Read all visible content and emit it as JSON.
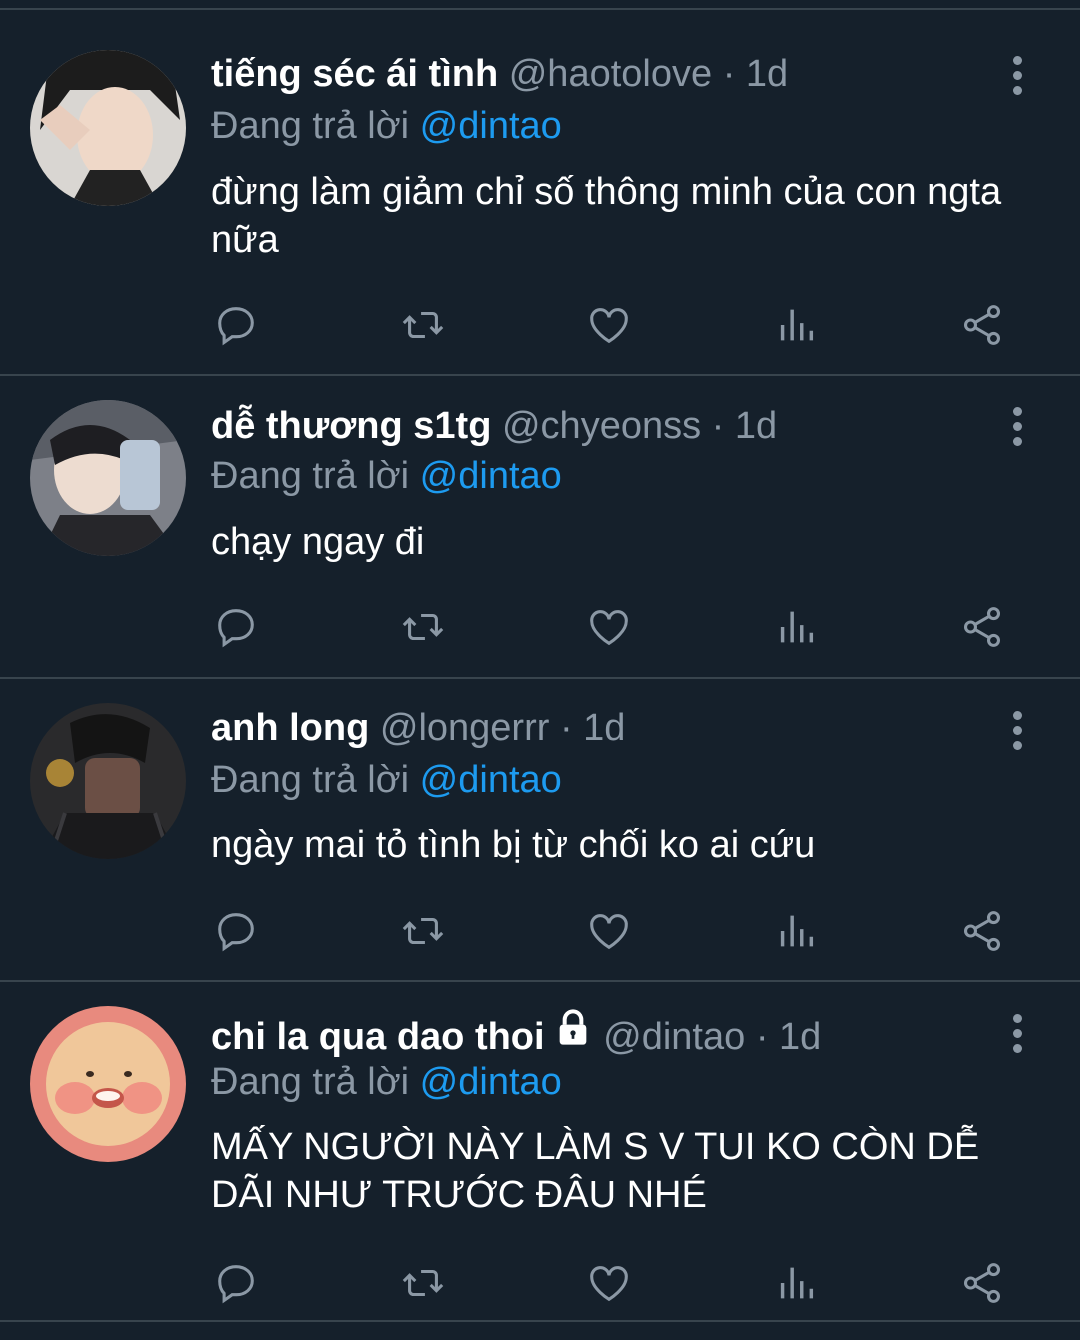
{
  "tweets": [
    {
      "name": "tiếng séc ái tình",
      "handle": "@haotolove",
      "time": "· 1d",
      "reply_prefix": "Đang trả lời",
      "reply_to": "@dintao",
      "text": "đừng làm giảm chỉ số thông minh của con ngta nữa",
      "avatar_color": "#3a3a3a",
      "locked": false
    },
    {
      "name": "dễ thương s1tg",
      "handle": "@chyeonss",
      "time": "· 1d",
      "reply_prefix": "Đang trả lời",
      "reply_to": "@dintao",
      "text": "chạy ngay đi",
      "avatar_color": "#4a4f57",
      "locked": false
    },
    {
      "name": "anh long",
      "handle": "@longerrr",
      "time": "· 1d",
      "reply_prefix": "Đang trả lời",
      "reply_to": "@dintao",
      "text": "ngày mai tỏ tình bị từ chối ko ai cứu",
      "avatar_color": "#2b2b2e",
      "locked": false
    },
    {
      "name": "chi la qua dao thoi",
      "handle": "@dintao",
      "time": "· 1d",
      "reply_prefix": "Đang trả lời",
      "reply_to": "@dintao",
      "text": "MẤY NGƯỜI NÀY LÀM S V TUI KO CÒN DỄ DÃI NHƯ TRƯỚC ĐÂU NHÉ",
      "avatar_color": "#e0857a",
      "locked": true
    }
  ],
  "icons": {
    "reply": "reply-icon",
    "retweet": "retweet-icon",
    "like": "heart-icon",
    "views": "views-icon",
    "share": "share-icon",
    "more": "more-vertical-icon",
    "lock": "lock-icon"
  },
  "colors": {
    "background": "#15202b",
    "secondary_text": "#8b98a5",
    "accent": "#1d9bf0",
    "divider": "#38444d"
  }
}
